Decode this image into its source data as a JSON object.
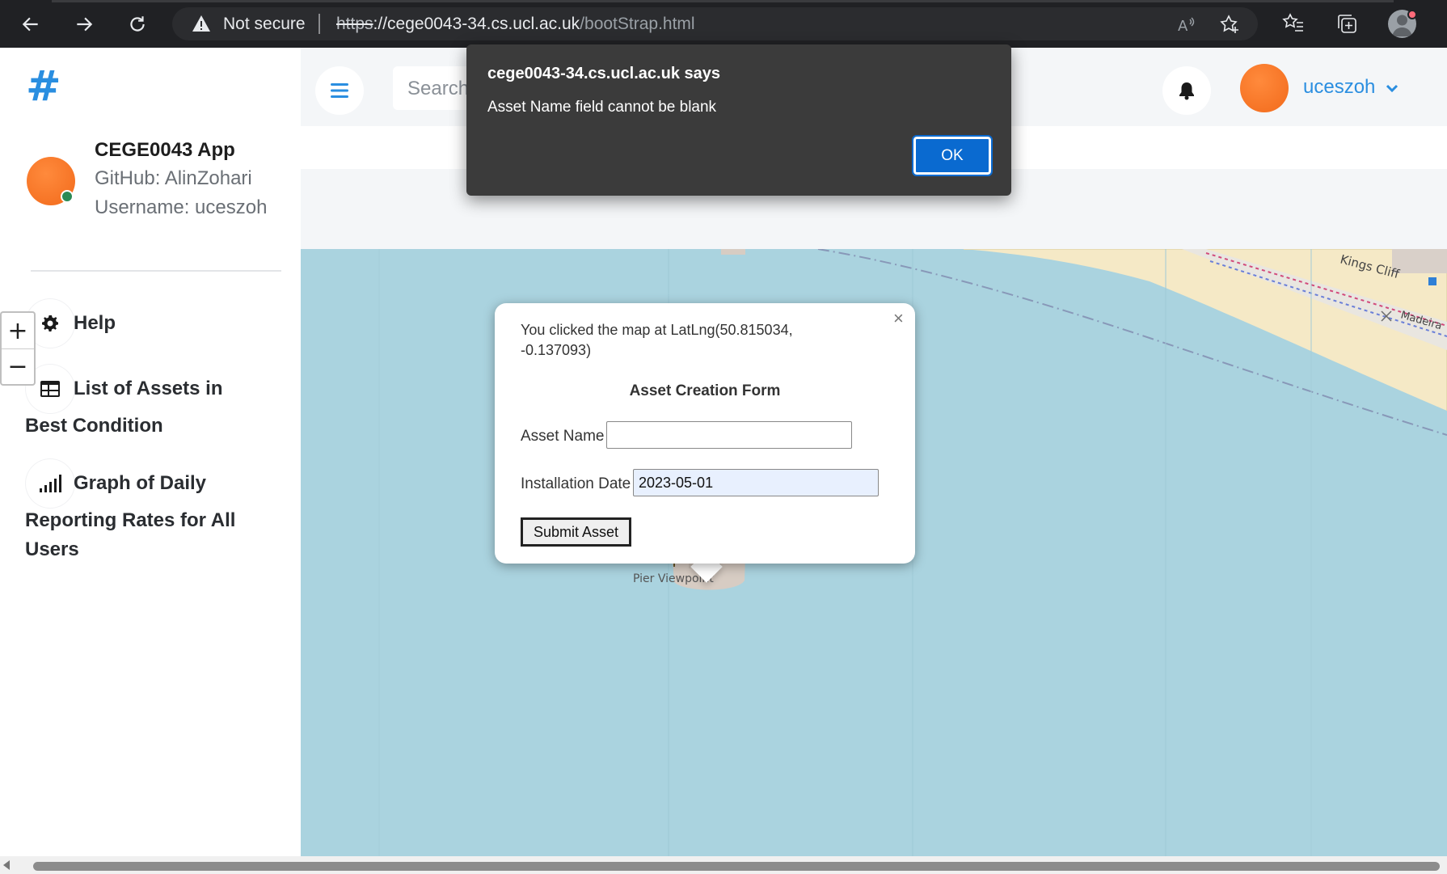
{
  "browser": {
    "security_label": "Not secure",
    "url_scheme": "https",
    "url_host": "://cege0043-34.cs.ucl.ac.uk",
    "url_path": "/bootStrap.html",
    "icons": [
      "back-arrow-icon",
      "forward-arrow-icon",
      "reload-icon",
      "warning-icon",
      "read-aloud-icon",
      "add-favorite-icon",
      "favorites-icon",
      "collections-icon",
      "profile-icon"
    ]
  },
  "sidebar": {
    "brand": "#",
    "app_title": "CEGE0043 App",
    "github": "GitHub: AlinZohari",
    "username": "Username: uceszoh",
    "items": [
      {
        "label": "Help",
        "icon": "gear-icon"
      },
      {
        "label_line1": "List of Assets in",
        "label_line2": "Best Condition",
        "icon": "table-icon"
      },
      {
        "label_line1": "Graph of Daily",
        "label_line2": "Reporting Rates for All",
        "label_line3": "Users",
        "icon": "signal-bars-icon"
      }
    ]
  },
  "topnav": {
    "search_placeholder": "Search",
    "user_name": "uceszoh"
  },
  "map": {
    "zoom_in": "+",
    "zoom_out": "−",
    "labels": {
      "kings_cliff": "Kings Cliff",
      "madeira": "Madeira",
      "pier_viewpoint": "Pier Viewpoint"
    },
    "popup": {
      "close": "×",
      "message": "You clicked the map at LatLng(50.815034, -0.137093)",
      "form_title": "Asset Creation Form",
      "asset_name_label": "Asset Name",
      "asset_name_value": "",
      "installation_date_label": "Installation Date",
      "installation_date_value": "2023-05-01",
      "submit_label": "Submit Asset"
    }
  },
  "alert": {
    "title": "cege0043-34.cs.ucl.ac.uk says",
    "message": "Asset Name field cannot be blank",
    "ok_label": "OK"
  },
  "colors": {
    "accent": "#2a8ee0",
    "sea": "#aad3df",
    "beach": "#f5e9c6",
    "avatar": "#f26a1b",
    "alert_bg": "#3b3b3b",
    "ok_button": "#0a6ad0"
  }
}
